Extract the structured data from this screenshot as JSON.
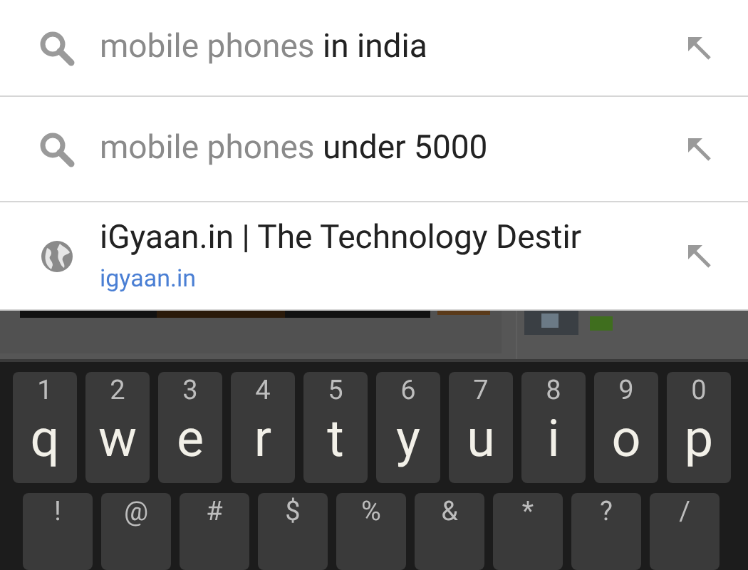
{
  "suggestions": [
    {
      "kind": "query",
      "query": "mobile phones",
      "completion": "in india"
    },
    {
      "kind": "query",
      "query": "mobile phones",
      "completion": "under 5000"
    },
    {
      "kind": "site",
      "title": "iGyaan.in | The Technology Destir",
      "url": "igyaan.in"
    }
  ],
  "keyboard": {
    "rows": [
      [
        {
          "hint": "1",
          "key": "q"
        },
        {
          "hint": "2",
          "key": "w"
        },
        {
          "hint": "3",
          "key": "e"
        },
        {
          "hint": "4",
          "key": "r"
        },
        {
          "hint": "5",
          "key": "t"
        },
        {
          "hint": "6",
          "key": "y"
        },
        {
          "hint": "7",
          "key": "u"
        },
        {
          "hint": "8",
          "key": "i"
        },
        {
          "hint": "9",
          "key": "o"
        },
        {
          "hint": "0",
          "key": "p"
        }
      ],
      [
        {
          "hint": "!"
        },
        {
          "hint": "@"
        },
        {
          "hint": "#"
        },
        {
          "hint": "$"
        },
        {
          "hint": "%"
        },
        {
          "hint": "&"
        },
        {
          "hint": "*"
        },
        {
          "hint": "?"
        },
        {
          "hint": "/"
        }
      ]
    ]
  }
}
